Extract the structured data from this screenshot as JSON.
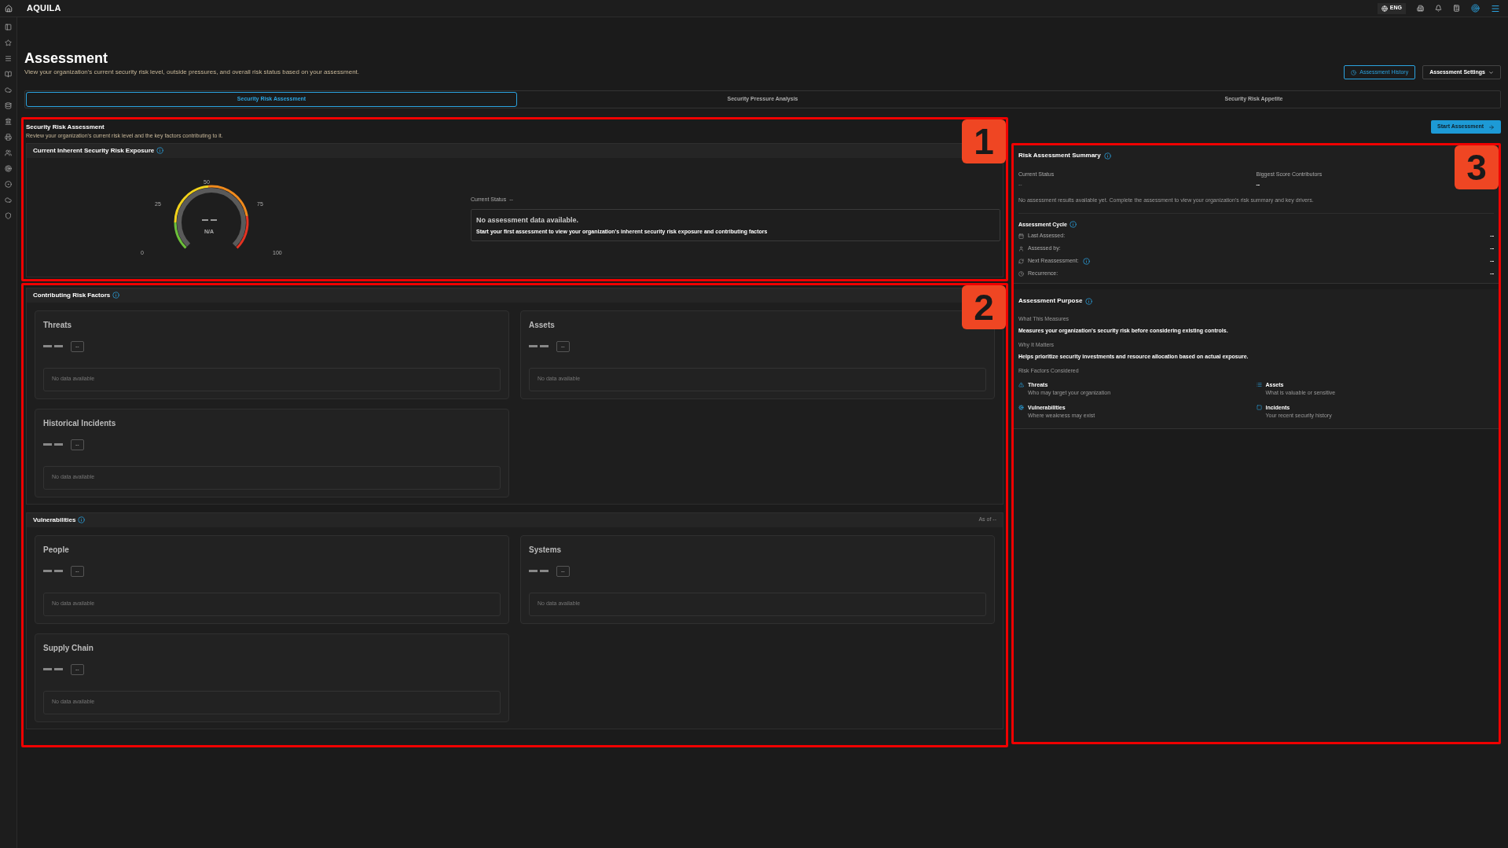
{
  "app": {
    "brand": "AQUILA",
    "language": "ENG"
  },
  "header": {
    "title": "Assessment",
    "subtitle": "View your organization's current security risk level, outside pressures, and overall risk status based on your assessment.",
    "history_button": "Assessment History",
    "settings_button": "Assessment Settings"
  },
  "tabs": [
    {
      "label": "Security Risk Assessment",
      "selected": true
    },
    {
      "label": "Security Pressure Analysis",
      "selected": false
    },
    {
      "label": "Security Risk Appetite",
      "selected": false
    }
  ],
  "exposure": {
    "title": "Security Risk Assessment",
    "subtitle": "Review your organization's current risk level and the key factors contributing to it.",
    "card_title": "Current Inherent Security Risk Exposure",
    "gauge_ticks": [
      "0",
      "25",
      "50",
      "75",
      "100"
    ],
    "gauge_label": "N/A",
    "status_label": "Current Status",
    "status_value": "--",
    "message_title": "No assessment data available.",
    "message_text": "Start your first assessment to view your organization's inherent security risk exposure and contributing factors"
  },
  "risk_factors": {
    "title": "Contributing Risk Factors",
    "cards": [
      {
        "title": "Threats",
        "badge": "--",
        "empty": "No data available"
      },
      {
        "title": "Assets",
        "badge": "--",
        "empty": "No data available"
      },
      {
        "title": "Historical Incidents",
        "badge": "--",
        "empty": "No data available"
      }
    ]
  },
  "vulnerabilities": {
    "title": "Vulnerabilities",
    "as_of": "As of --",
    "cards": [
      {
        "title": "People",
        "badge": "--",
        "empty": "No data available"
      },
      {
        "title": "Systems",
        "badge": "--",
        "empty": "No data available"
      },
      {
        "title": "Supply Chain",
        "badge": "--",
        "empty": "No data available"
      }
    ]
  },
  "start_button": "Start Assessment",
  "summary": {
    "title": "Risk Assessment Summary",
    "status_label": "Current Status",
    "status_value": "--",
    "contributors_label": "Biggest Score Contributors",
    "contributors_value": "--",
    "note": "No assessment results available yet. Complete the assessment to view your organization's risk summary and key drivers.",
    "cycle_title": "Assessment Cycle",
    "cycle": [
      {
        "kind": "calendar",
        "label": "Last Assessed:",
        "value": "--",
        "info": false
      },
      {
        "kind": "person",
        "label": "Assessed by:",
        "value": "--",
        "info": false
      },
      {
        "kind": "refresh",
        "label": "Next Reassessment:",
        "value": "--",
        "info": true
      },
      {
        "kind": "clock",
        "label": "Recurrence:",
        "value": "--",
        "info": false
      }
    ]
  },
  "purpose": {
    "title": "Assessment Purpose",
    "measures_label": "What This Measures",
    "measures_text": "Measures your organization's security risk before considering existing controls.",
    "matters_label": "Why It Matters",
    "matters_text": "Helps prioritize security investments and resource allocation based on actual exposure.",
    "factors_label": "Risk Factors Considered",
    "factors": [
      {
        "kind": "warning",
        "title": "Threats",
        "text": "Who may target your organization"
      },
      {
        "kind": "list",
        "title": "Assets",
        "text": "What is valuable or sensitive"
      },
      {
        "kind": "gear",
        "title": "Vulnerabilities",
        "text": "Where weakness may exist"
      },
      {
        "kind": "alert",
        "title": "Incidents",
        "text": "Your recent security history"
      }
    ]
  },
  "annotations": [
    {
      "number": "1"
    },
    {
      "number": "2"
    },
    {
      "number": "3"
    }
  ]
}
